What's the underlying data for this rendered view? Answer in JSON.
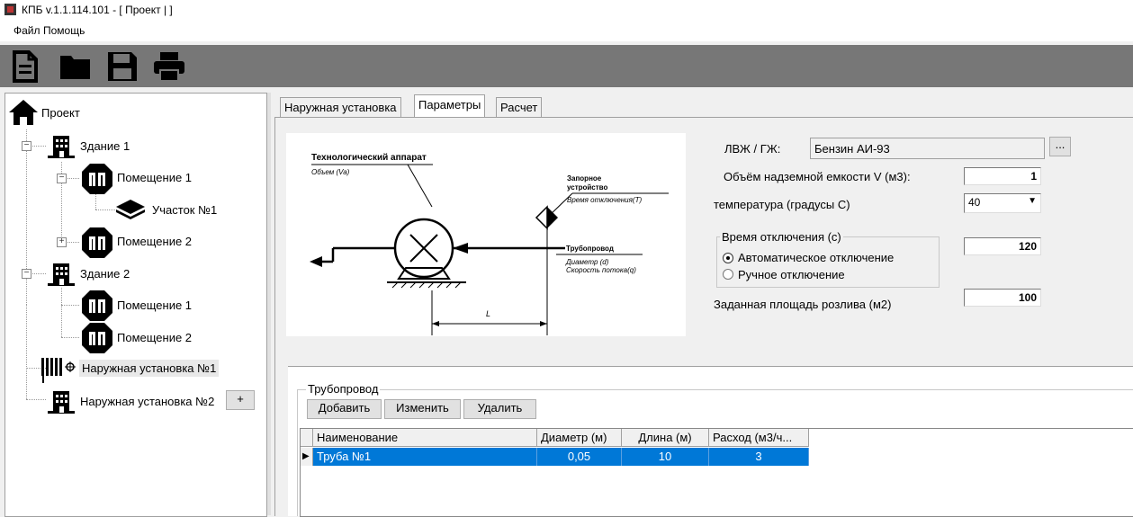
{
  "window": {
    "title": "КПБ v.1.1.114.101 - [ Проект | ]"
  },
  "menu": {
    "file": "Файл",
    "help": "Помощь"
  },
  "toolbar": {
    "icons": [
      "new-file-icon",
      "open-folder-icon",
      "save-icon",
      "print-icon"
    ]
  },
  "tree": {
    "root": "Проект",
    "building1": "Здание 1",
    "room1": "Помещение 1",
    "section1": "Участок №1",
    "room2": "Помещение 2",
    "building2": "Здание 2",
    "b2_room1": "Помещение 1",
    "b2_room2": "Помещение 2",
    "outdoor1": "Наружная установка №1",
    "outdoor2": "Наружная установка №2",
    "add_button": "+"
  },
  "tabs": {
    "outdoor": "Наружная установка",
    "params": "Параметры",
    "calc": "Расчет"
  },
  "diagram": {
    "apparatus_title": "Технологический аппарат",
    "apparatus_volume": "Объем (Va)",
    "valve_title1": "Запорное",
    "valve_title2": "устройство",
    "valve_time": "Время отключения(T)",
    "pipe_title": "Трубопровод",
    "pipe_diam": "Диаметр (d)",
    "pipe_flow": "Скорость потока(q)",
    "length": "L"
  },
  "params": {
    "liquid_label": "ЛВЖ / ГЖ:",
    "liquid_value": "Бензин АИ-93",
    "browse": "...",
    "volume_label": "Объём надземной емкости V (м3):",
    "volume_value": "1",
    "temp_label": "температура  (градусы С)",
    "temp_value": "40",
    "shutoff_group": "Время отключения (с)",
    "auto": "Автоматическое отключение",
    "manual": "Ручное отключение",
    "shutoff_value": "120",
    "area_label": "Заданная площадь розлива (м2)",
    "area_value": "100"
  },
  "pipeline": {
    "group": "Трубопровод",
    "add": "Добавить",
    "edit": "Изменить",
    "delete": "Удалить",
    "columns": [
      "Наименование",
      "Диаметр (м)",
      "Длина (м)",
      "Расход (м3/ч..."
    ],
    "rows": [
      {
        "name": "Труба №1",
        "diameter": "0,05",
        "length": "10",
        "flow": "3"
      }
    ]
  }
}
